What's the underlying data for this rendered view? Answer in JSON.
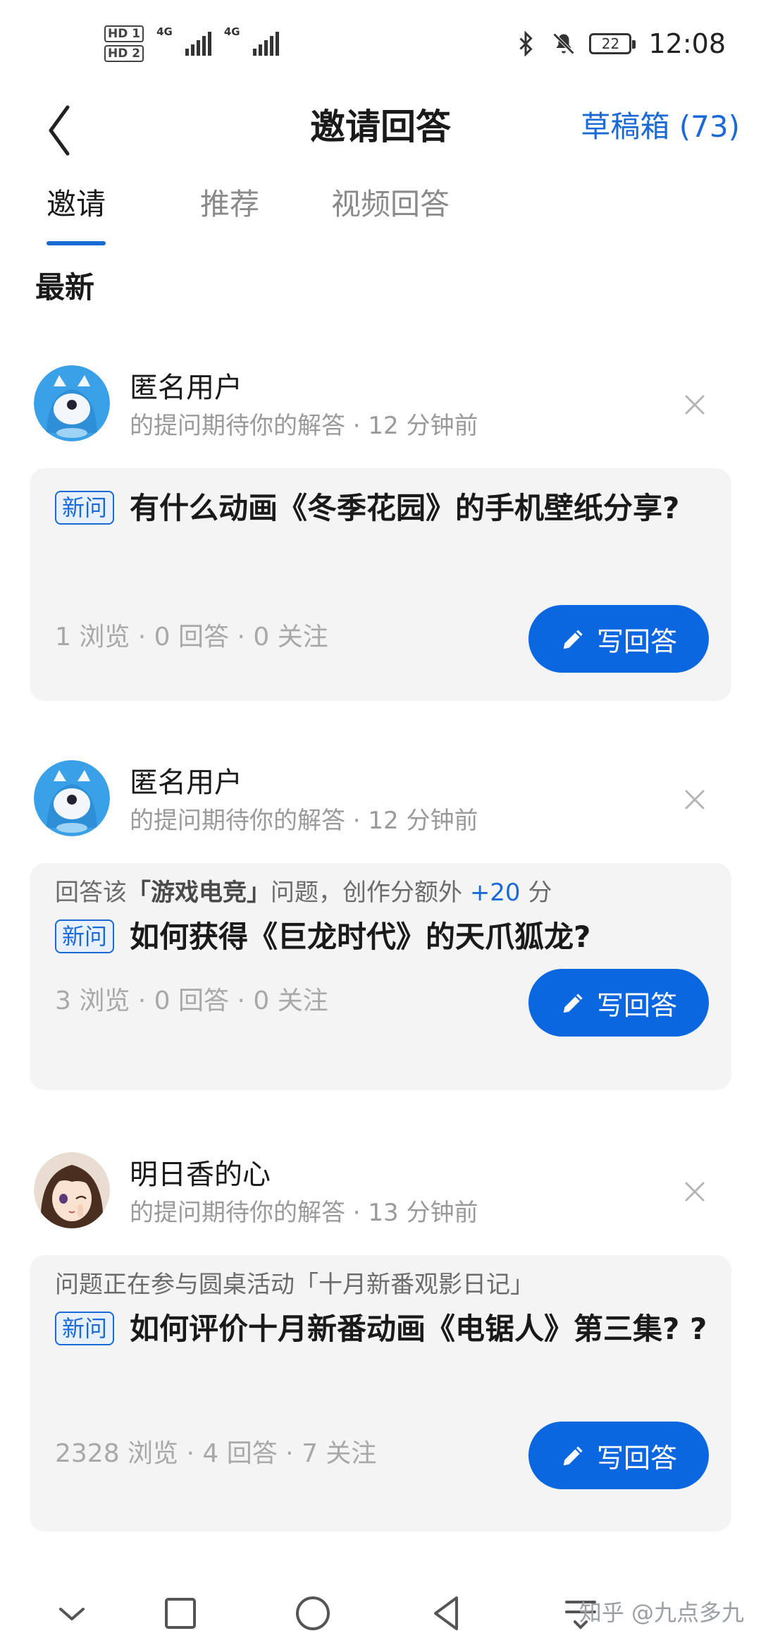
{
  "status_bar": {
    "hd1": "HD 1",
    "hd2": "HD 2",
    "net1": "4G",
    "net2": "4G",
    "battery": "22",
    "time": "12:08",
    "icons": [
      "bluetooth-icon",
      "mute-icon",
      "battery-icon"
    ]
  },
  "header": {
    "back_icon": "back-arrow-icon",
    "title": "邀请回答",
    "drafts": "草稿箱 (73)"
  },
  "tabs": [
    {
      "label": "邀请",
      "active": true
    },
    {
      "label": "推荐",
      "active": false
    },
    {
      "label": "视频回答",
      "active": false
    }
  ],
  "section_title": "最新",
  "items": [
    {
      "user": "匿名用户",
      "meta": "的提问期待你的解答 · 12 分钟前",
      "avatar": "anonymous-avatar",
      "badge": "新问",
      "title": "有什么动画《冬季花园》的手机壁纸分享?",
      "stats": "1 浏览 · 0 回答 · 0 关注",
      "button": "写回答"
    },
    {
      "user": "匿名用户",
      "meta": "的提问期待你的解答 · 12 分钟前",
      "avatar": "anonymous-avatar",
      "context_prefix": "回答该",
      "context_topic": "「游戏电竞」",
      "context_mid": "问题，创作分额外 ",
      "context_plus": "+20",
      "context_suffix": " 分",
      "badge": "新问",
      "title": "如何获得《巨龙时代》的天爪狐龙?",
      "stats": "3 浏览 · 0 回答 · 0 关注",
      "button": "写回答"
    },
    {
      "user": "明日香的心",
      "meta": "的提问期待你的解答 · 13 分钟前",
      "avatar": "anime-girl-avatar",
      "context": "问题正在参与圆桌活动「十月新番观影日记」",
      "badge": "新问",
      "title": "如何评价十月新番动画《电锯人》第三集? ?",
      "stats": "2328 浏览 · 4 回答 · 7 关注",
      "button": "写回答"
    }
  ],
  "nav": [
    "collapse-icon",
    "recents-icon",
    "home-icon",
    "back-icon",
    "menu-icon"
  ],
  "watermark": "知乎 @九点多九",
  "colors": {
    "accent": "#0b67e0",
    "card_bg": "#f4f4f4"
  }
}
